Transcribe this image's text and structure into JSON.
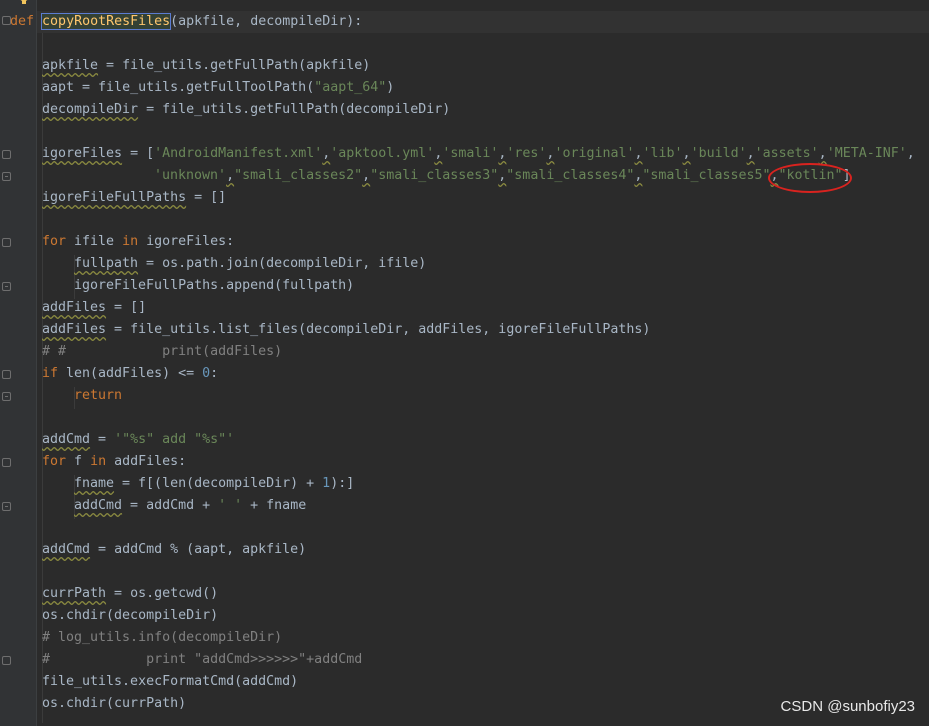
{
  "watermark": "CSDN @sunbofiy23",
  "code": {
    "l1": {
      "def": "def",
      "name": "copyRootResFiles",
      "params": "(apkfile, decompileDir):"
    },
    "l3": {
      "var": "apkfile",
      "rest": " = file_utils.getFullPath(apkfile)"
    },
    "l4": {
      "var": "aapt",
      "rest_a": " = file_utils.getFullToolPath(",
      "str": "\"aapt_64\"",
      "rest_b": ")"
    },
    "l5": {
      "var": "decompileDir",
      "rest": " = file_utils.getFullPath(decompileDir)"
    },
    "l7": {
      "var": "igoreFiles",
      "rest": " = [",
      "items": [
        "'AndroidManifest.xml'",
        "'apktool.yml'",
        "'smali'",
        "'res'",
        "'original'",
        "'lib'",
        "'build'",
        "'assets'",
        "'META-INF'"
      ]
    },
    "l8": {
      "items": [
        "'unknown'",
        "\"smali_classes2\"",
        "\"smali_classes3\"",
        "\"smali_classes4\"",
        "\"smali_classes5\""
      ],
      "highlight": "\"kotlin\"",
      "end": "]"
    },
    "l9": {
      "var": "igoreFileFullPaths",
      "rest": " = []"
    },
    "l11": {
      "kw1": "for",
      "var": " ifile ",
      "kw2": "in",
      "rest": " igoreFiles:"
    },
    "l12": {
      "var": "fullpath",
      "rest": " = os.path.join(decompileDir, ifile)"
    },
    "l13": {
      "text": "igoreFileFullPaths.append(fullpath)"
    },
    "l14": {
      "var": "addFiles",
      "rest": " = []"
    },
    "l15": {
      "var": "addFiles",
      "rest": " = file_utils.list_files(decompileDir, addFiles, igoreFileFullPaths)"
    },
    "l16": {
      "comment": "# #            print(addFiles)"
    },
    "l17": {
      "kw": "if",
      "rest_a": " len(addFiles) <= ",
      "num": "0",
      "rest_b": ":"
    },
    "l18": {
      "kw": "return"
    },
    "l20": {
      "var": "addCmd",
      "rest": " = ",
      "str": "'\"%s\" add \"%s\"'"
    },
    "l21": {
      "kw1": "for",
      "var": " f ",
      "kw2": "in",
      "rest": " addFiles:"
    },
    "l22": {
      "var": "fname",
      "rest_a": " = f[(len(decompileDir) + ",
      "num": "1",
      "rest_b": "):]"
    },
    "l23": {
      "var": "addCmd",
      "rest_a": " = addCmd + ",
      "str": "' '",
      "rest_b": " + fname"
    },
    "l25": {
      "var": "addCmd",
      "rest": " = addCmd % (aapt, apkfile)"
    },
    "l27": {
      "var": "currPath",
      "rest": " = os.getcwd()"
    },
    "l28": {
      "text": "os.chdir(decompileDir)"
    },
    "l29": {
      "comment": "# log_utils.info(decompileDir)"
    },
    "l30": {
      "comment": "#            print \"addCmd>>>>>>\"+addCmd"
    },
    "l31": {
      "text": "file_utils.execFormatCmd(addCmd)"
    },
    "l32": {
      "text": "os.chdir(currPath)"
    }
  }
}
